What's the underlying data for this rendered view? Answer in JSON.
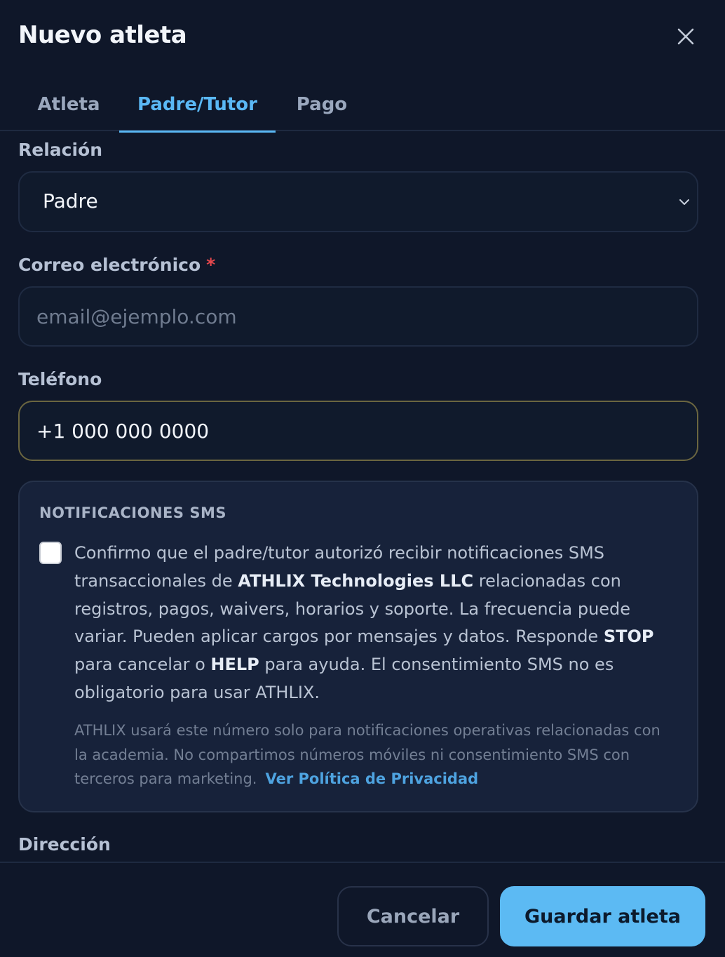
{
  "header": {
    "title": "Nuevo atleta",
    "close_icon": "close-icon"
  },
  "tabs": [
    {
      "label": "Atleta",
      "active": false
    },
    {
      "label": "Padre/Tutor",
      "active": true
    },
    {
      "label": "Pago",
      "active": false
    }
  ],
  "form": {
    "relation": {
      "label": "Relación",
      "value": "Padre",
      "icon": "chevron-down-icon"
    },
    "email": {
      "label": "Correo electrónico",
      "required_mark": "*",
      "value": "",
      "placeholder": "email@ejemplo.com"
    },
    "phone": {
      "label": "Teléfono",
      "value": "+1 000 000 0000"
    },
    "sms": {
      "title": "NOTIFICACIONES SMS",
      "checked": false,
      "consent": {
        "part1": "Confirmo que el padre/tutor autorizó recibir notificaciones SMS transaccionales de ",
        "company": "ATHLIX Technologies LLC",
        "part2": " relacionadas con registros, pagos, waivers, horarios y soporte. La frecuencia puede variar. Pueden aplicar cargos por mensajes y datos. Responde ",
        "stop": "STOP",
        "part3": " para cancelar o ",
        "help": "HELP",
        "part4": " para ayuda. El consentimiento SMS no es obligatorio para usar ATHLIX."
      },
      "fine_print": "ATHLIX usará este número solo para notificaciones operativas relacionadas con la academia. No compartimos números móviles ni consentimiento SMS con terceros para marketing.",
      "privacy_link": "Ver Política de Privacidad"
    },
    "address": {
      "label": "Dirección"
    }
  },
  "footer": {
    "cancel_label": "Cancelar",
    "save_label": "Guardar atleta"
  },
  "colors": {
    "background": "#0f1729",
    "accent": "#5ab8f5",
    "required": "#e5484d",
    "primary_button": "#5cbaf3"
  }
}
